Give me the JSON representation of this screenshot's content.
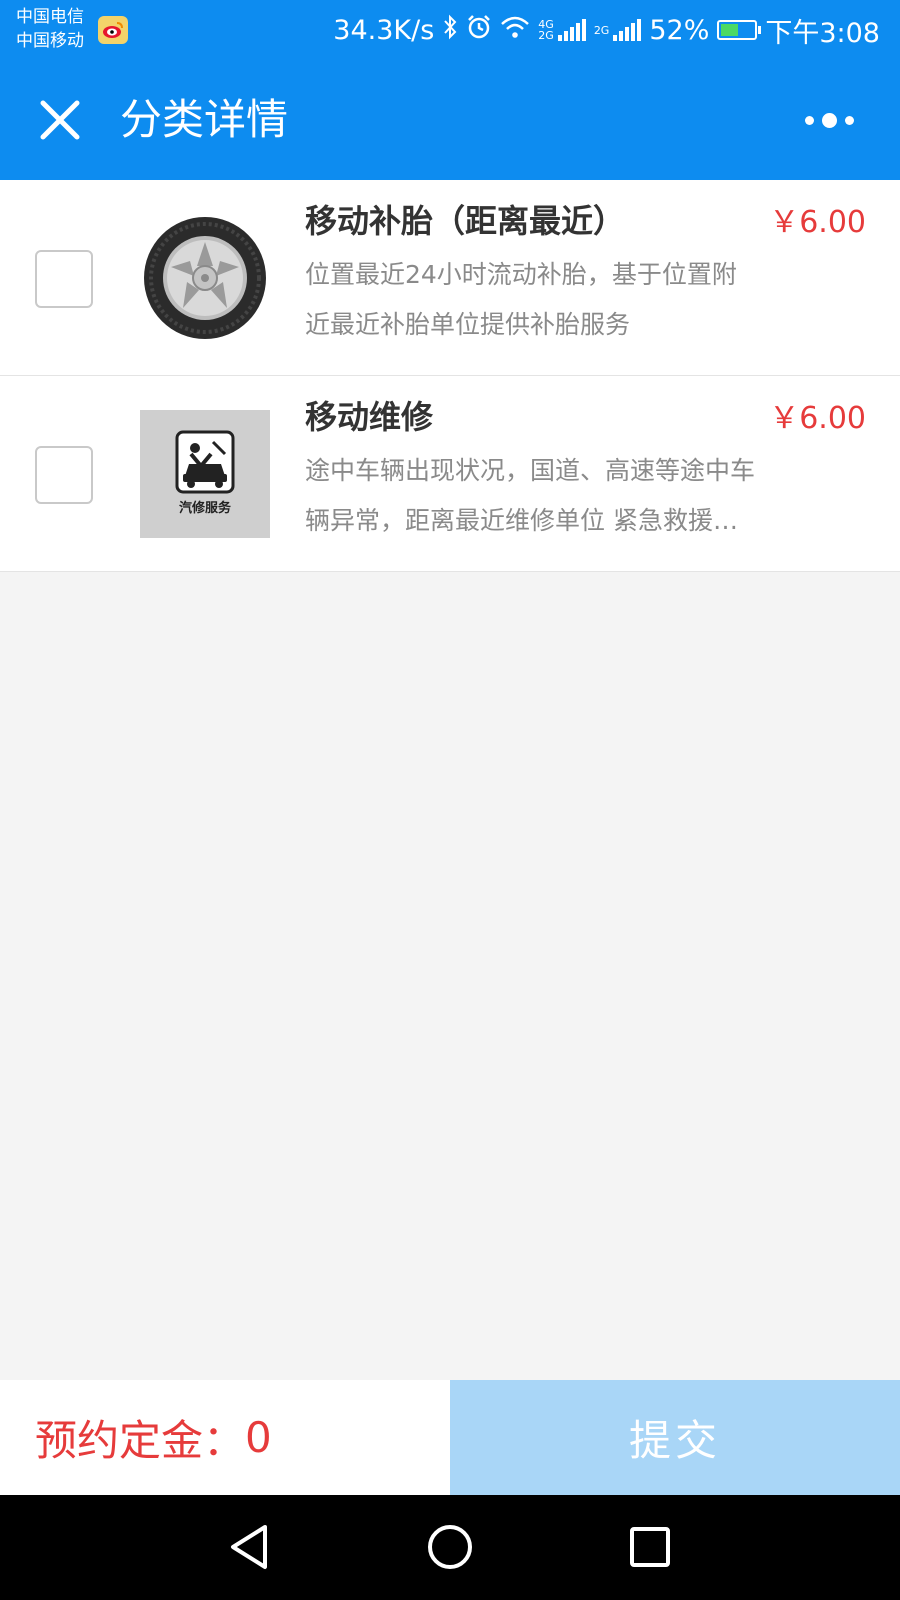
{
  "status_bar": {
    "carrier_1": "中国电信",
    "carrier_2": "中国移动",
    "network_speed": "34.3K/s",
    "network_tag_top": "4G",
    "network_tag_bottom": "2G",
    "network_tag_2": "2G",
    "battery_percent": "52%",
    "battery_level": 0.52,
    "time": "下午3:08"
  },
  "header": {
    "title": "分类详情"
  },
  "services": [
    {
      "name": "移动补胎（距离最近）",
      "price": "￥6.00",
      "description": "位置最近24小时流动补胎，基于位置附近最近补胎单位提供补胎服务",
      "image_icon": "tire-icon"
    },
    {
      "name": "移动维修",
      "price": "￥6.00",
      "description": "途中车辆出现状况，国道、高速等途中车辆异常，距离最近维修单位 紧急救援服务",
      "image_icon": "car-repair-icon",
      "image_caption": "汽修服务"
    }
  ],
  "footer": {
    "deposit_label": "预约定金：",
    "deposit_value": "0",
    "submit_label": "提交"
  },
  "colors": {
    "brand": "#0d8cf0",
    "price": "#e63b3b",
    "submit_disabled": "#a9d6f7"
  }
}
